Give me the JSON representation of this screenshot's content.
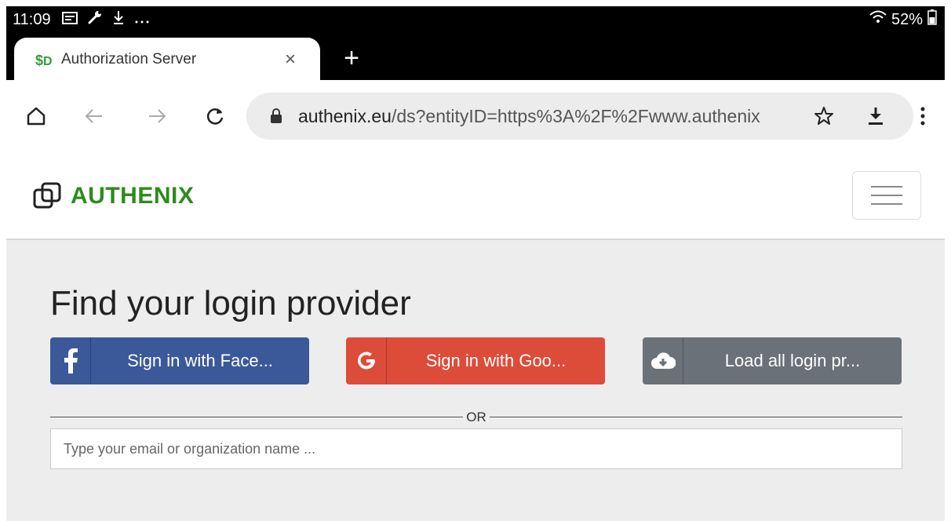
{
  "status_bar": {
    "time": "11:09",
    "battery": "52%",
    "icons": [
      "notification-icon",
      "wrench-icon",
      "download-icon",
      "more-icon",
      "wifi-icon",
      "battery-icon"
    ]
  },
  "tab": {
    "title": "Authorization Server",
    "close_symbol": "×",
    "new_tab_symbol": "+"
  },
  "toolbar": {
    "url_host": "authenix.eu",
    "url_path": "/ds?entityID=https%3A%2F%2Fwww.authenix"
  },
  "site": {
    "brand": "AUTHENIX"
  },
  "main": {
    "heading": "Find your login provider",
    "buttons": [
      {
        "label": "Sign in with Face...",
        "icon": "facebook-icon",
        "color": "#3b5998"
      },
      {
        "label": "Sign in with Goo...",
        "icon": "google-icon",
        "color": "#dd4b39"
      },
      {
        "label": "Load all login pr...",
        "icon": "cloud-download-icon",
        "color": "#6b7178"
      }
    ],
    "separator": "OR",
    "search_placeholder": "Type your email or organization name ..."
  },
  "colors": {
    "brand_green": "#2e8b1d",
    "background": "#ededed"
  }
}
